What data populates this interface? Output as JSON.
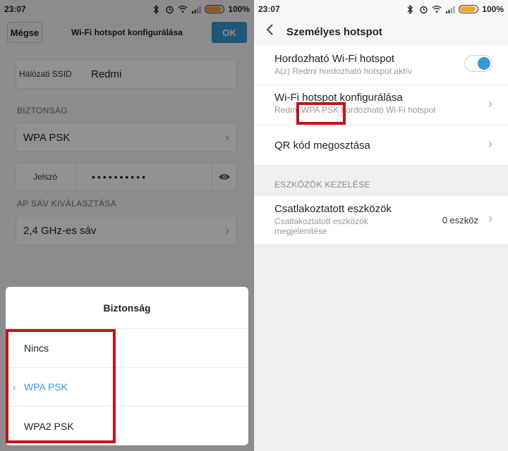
{
  "left": {
    "status": {
      "time": "23:07",
      "battery": "100%"
    },
    "header": {
      "cancel_label": "Mégse",
      "title": "Wi-Fi hotspot konfigurálása",
      "ok_label": "OK"
    },
    "ssid": {
      "label": "Hálózati SSID",
      "value": "Redmi"
    },
    "security_section": "BIZTONSÁG",
    "security_value": "WPA PSK",
    "password": {
      "label": "Jelszó",
      "masked": "••••••••••"
    },
    "ap_band_section": "AP SÁV KIVÁLASZTÁSA",
    "ap_band_value": "2,4 GHz-es sáv",
    "sheet": {
      "title": "Biztonság",
      "options": [
        {
          "label": "Nincs",
          "selected": false
        },
        {
          "label": "WPA PSK",
          "selected": true
        },
        {
          "label": "WPA2 PSK",
          "selected": false
        }
      ]
    }
  },
  "right": {
    "status": {
      "time": "23:07",
      "battery": "100%"
    },
    "header": {
      "title": "Személyes hotspot"
    },
    "portable": {
      "title": "Hordozható Wi-Fi hotspot",
      "subtitle": "A(z) Redmi hordozható hotspot aktív",
      "enabled": true
    },
    "configure": {
      "title": "Wi-Fi hotspot konfigurálása",
      "subtitle_prefix": "Redmi",
      "subtitle_highlight": "WPA PSK",
      "subtitle_suffix": "hordozható Wi-Fi hotspot"
    },
    "qr": {
      "title": "QR kód megosztása"
    },
    "devices_section": "ESZKÖZÖK KEZELÉSE",
    "connected": {
      "title": "Csatlakoztatott eszközök",
      "subtitle": "Csatlakoztatott eszközök megjelenítése",
      "count": "0 eszköz"
    }
  },
  "colors": {
    "accent": "#3a97d9",
    "highlight_box": "#c4141b",
    "battery": "#f5a623"
  }
}
